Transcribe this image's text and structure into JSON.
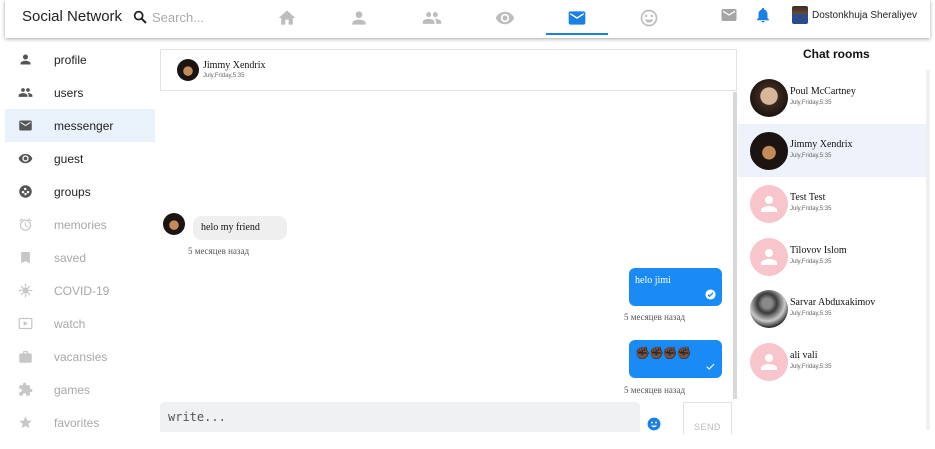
{
  "app": {
    "title": "Social Network"
  },
  "search": {
    "placeholder": "Search..."
  },
  "nav": {
    "items": [
      "home-icon",
      "person-icon",
      "people-icon",
      "eye-icon",
      "mail-icon",
      "smiley-icon"
    ],
    "active": "mail-icon"
  },
  "header_right": {
    "user_name": "Dostonkhuja Sheraliyev"
  },
  "sidebar": {
    "items": [
      {
        "label": "profile",
        "icon": "person-icon"
      },
      {
        "label": "users",
        "icon": "people-icon"
      },
      {
        "label": "messenger",
        "icon": "mail-icon"
      },
      {
        "label": "guest",
        "icon": "eye-icon"
      },
      {
        "label": "groups",
        "icon": "groups-icon"
      },
      {
        "label": "memories",
        "icon": "alarm-icon"
      },
      {
        "label": "saved",
        "icon": "bookmark-icon"
      },
      {
        "label": "COVID-19",
        "icon": "virus-icon"
      },
      {
        "label": "watch",
        "icon": "video-icon"
      },
      {
        "label": "vacansies",
        "icon": "briefcase-icon"
      },
      {
        "label": "games",
        "icon": "puzzle-icon"
      },
      {
        "label": "favorites",
        "icon": "star-icon"
      }
    ],
    "active": "messenger"
  },
  "chat": {
    "contact_name": "Jimmy Xendrix",
    "contact_time": "July,Friday,5:35",
    "messages": [
      {
        "direction": "in",
        "text": "helo my friend",
        "time": "5 месяцев назад"
      },
      {
        "direction": "out",
        "text": "helo jimi",
        "time": "5 месяцев назад",
        "read": true
      },
      {
        "direction": "out",
        "text": "✊🏿✊🏿✊🏿✊🏿",
        "time": "5 месяцев назад",
        "read": false
      }
    ],
    "input_placeholder": "write...",
    "send_label": "SEND"
  },
  "chat_rooms": {
    "title": "Chat rooms",
    "rooms": [
      {
        "name": "Poul McCartney",
        "time": "July,Friday,5:35",
        "avatar": "photo"
      },
      {
        "name": "Jimmy Xendrix",
        "time": "July,Friday,5:35",
        "avatar": "photo",
        "active": true
      },
      {
        "name": "Test Test",
        "time": "July,Friday,5:35",
        "avatar": "default"
      },
      {
        "name": "Tilovov Islom",
        "time": "July,Friday,5:35",
        "avatar": "default"
      },
      {
        "name": "Sarvar Abduxakimov",
        "time": "July,Friday,5:35",
        "avatar": "photo"
      },
      {
        "name": "ali vali",
        "time": "July,Friday,5:35",
        "avatar": "default"
      }
    ]
  },
  "colors": {
    "accent": "#1a80e5",
    "bubble_out": "#1a8bf5",
    "default_avatar": "#f8c5cc"
  }
}
